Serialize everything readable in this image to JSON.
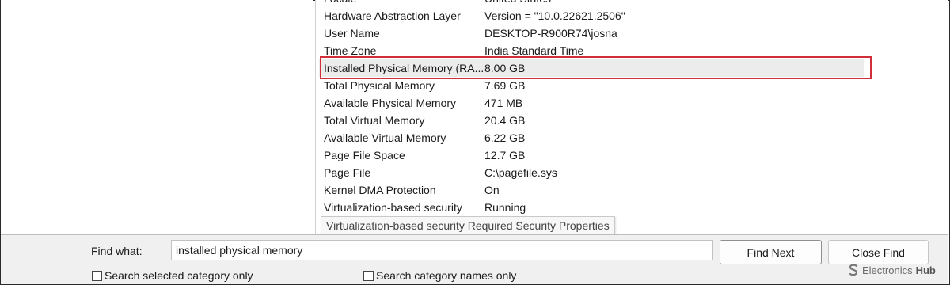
{
  "details": {
    "cut_row": {
      "item": "Locale",
      "value": "United States"
    },
    "rows": [
      {
        "item": "Hardware Abstraction Layer",
        "value": "Version = \"10.0.22621.2506\""
      },
      {
        "item": "User Name",
        "value": "DESKTOP-R900R74\\josna"
      },
      {
        "item": "Time Zone",
        "value": "India Standard Time"
      },
      {
        "item": "Installed Physical Memory (RA...",
        "value": "8.00 GB",
        "selected": true
      },
      {
        "item": "Total Physical Memory",
        "value": "7.69 GB"
      },
      {
        "item": "Available Physical Memory",
        "value": "471 MB"
      },
      {
        "item": "Total Virtual Memory",
        "value": "20.4 GB"
      },
      {
        "item": "Available Virtual Memory",
        "value": "6.22 GB"
      },
      {
        "item": "Page File Space",
        "value": "12.7 GB"
      },
      {
        "item": "Page File",
        "value": "C:\\pagefile.sys"
      },
      {
        "item": "Kernel DMA Protection",
        "value": "On"
      },
      {
        "item": "Virtualization-based security",
        "value": "Running"
      }
    ],
    "tooltip": "Virtualization-based security Required Security Properties"
  },
  "find": {
    "label": "Find what:",
    "query": "installed physical memory",
    "find_next_label": "Find Next",
    "close_find_label": "Close Find",
    "search_selected_label": "Search selected category only",
    "search_names_label": "Search category names only"
  },
  "watermark": {
    "brand_main": "Electronics",
    "brand_accent": "Hub",
    "logo_icon": "s-logo-icon"
  },
  "colors": {
    "highlight": "#d32f3a",
    "selected_row": "#ececec",
    "find_bar": "#f0f0f0"
  }
}
